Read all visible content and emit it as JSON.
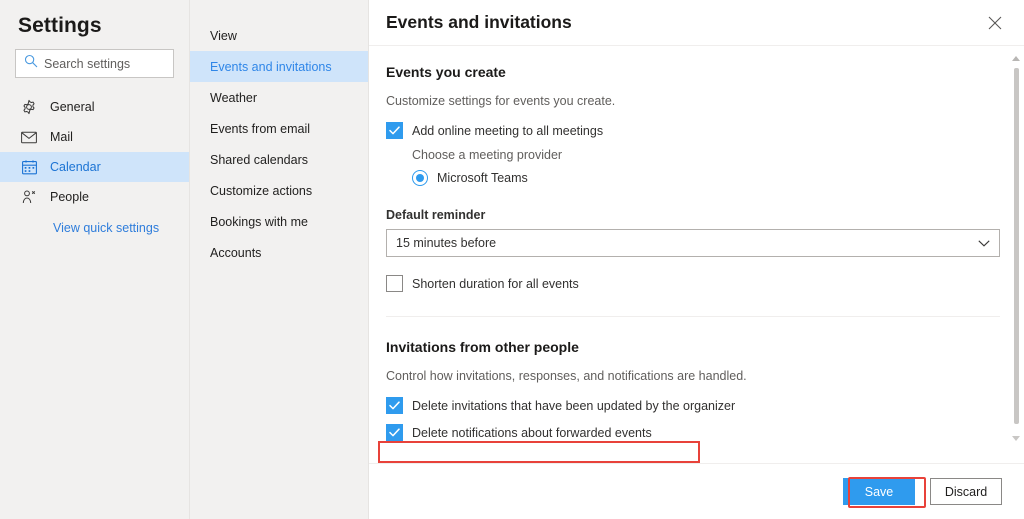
{
  "sidebar": {
    "title": "Settings",
    "search": {
      "placeholder": "Search settings",
      "value": "",
      "icon": "search-icon"
    },
    "items": [
      {
        "label": "General",
        "icon": "gear-icon",
        "selected": false
      },
      {
        "label": "Mail",
        "icon": "envelope-icon",
        "selected": false
      },
      {
        "label": "Calendar",
        "icon": "calendar-icon",
        "selected": true
      },
      {
        "label": "People",
        "icon": "people-icon",
        "selected": false
      }
    ],
    "quick_settings_link": "View quick settings"
  },
  "subnav": {
    "items": [
      {
        "label": "View",
        "selected": false
      },
      {
        "label": "Events and invitations",
        "selected": true
      },
      {
        "label": "Weather",
        "selected": false
      },
      {
        "label": "Events from email",
        "selected": false
      },
      {
        "label": "Shared calendars",
        "selected": false
      },
      {
        "label": "Customize actions",
        "selected": false
      },
      {
        "label": "Bookings with me",
        "selected": false
      },
      {
        "label": "Accounts",
        "selected": false
      }
    ]
  },
  "panel": {
    "title": "Events and invitations",
    "close_icon": "close-icon",
    "section_one": {
      "heading": "Events you create",
      "description": "Customize settings for events you create.",
      "online_meeting": {
        "label": "Add online meeting to all meetings",
        "checked": true
      },
      "provider": {
        "prompt": "Choose a meeting provider",
        "option_label": "Microsoft Teams",
        "selected": true
      },
      "reminder": {
        "label": "Default reminder",
        "value": "15 minutes before",
        "chevron_icon": "chevron-down-icon"
      },
      "shorten_duration": {
        "label": "Shorten duration for all events",
        "checked": false
      }
    },
    "section_two": {
      "heading": "Invitations from other people",
      "description": "Control how invitations, responses, and notifications are handled.",
      "delete_updated": {
        "label": "Delete invitations that have been updated by the organizer",
        "checked": true
      },
      "delete_forwarded": {
        "label": "Delete notifications about forwarded events",
        "checked": true,
        "highlighted": true
      }
    },
    "footer": {
      "save_label": "Save",
      "discard_label": "Discard"
    },
    "scrollbar": {
      "up_icon": "scroll-up-arrow-icon",
      "down_icon": "scroll-down-arrow-icon"
    }
  },
  "colors": {
    "accent": "#2f9bee",
    "selection": "#cfe4fa",
    "sidebar_bg": "#f2f1f0",
    "annotation": "#e8423a",
    "link": "#2f7ddb"
  }
}
